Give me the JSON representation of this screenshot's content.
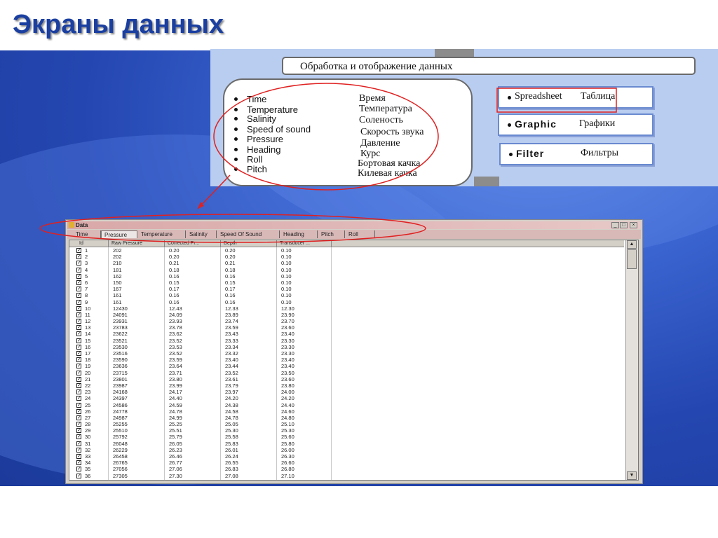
{
  "slide": {
    "title": "Экраны данных"
  },
  "diagram": {
    "process_label": "Обработка и отображение данных",
    "parameters": [
      {
        "en": "Time",
        "ru": "Время"
      },
      {
        "en": "Temperature",
        "ru": "Температура"
      },
      {
        "en": "Salinity",
        "ru": "Соленость"
      },
      {
        "en": "Speed of sound",
        "ru": "Скорость звука"
      },
      {
        "en": "Pressure",
        "ru": "Давление"
      },
      {
        "en": "Heading",
        "ru": "Курс"
      },
      {
        "en": "Roll",
        "ru": "Бортовая качка"
      },
      {
        "en": "Pitch",
        "ru": "Килевая качка"
      }
    ],
    "options": [
      {
        "en": "Spreadsheet",
        "ru": "Таблица"
      },
      {
        "en": "Graphic",
        "ru": "Графики"
      },
      {
        "en": "Filter",
        "ru": "Фильтры"
      }
    ]
  },
  "window": {
    "title": "Data",
    "controls": {
      "minimize": "_",
      "maximize": "□",
      "close": "×"
    },
    "tabs": [
      "Time",
      "Pressure",
      "Temperature",
      "Salinity",
      "Speed Of Sound",
      "Heading",
      "Pitch",
      "Roll"
    ],
    "active_tab": "Pressure",
    "columns": [
      "Id",
      "Raw Pressure",
      "Corrected Pr...",
      "Depth",
      "Transducer ..."
    ],
    "rows": [
      [
        "1",
        "202",
        "0.20",
        "0.20",
        "0.10"
      ],
      [
        "2",
        "202",
        "0.20",
        "0.20",
        "0.10"
      ],
      [
        "3",
        "210",
        "0.21",
        "0.21",
        "0.10"
      ],
      [
        "4",
        "181",
        "0.18",
        "0.18",
        "0.10"
      ],
      [
        "5",
        "162",
        "0.16",
        "0.16",
        "0.10"
      ],
      [
        "6",
        "150",
        "0.15",
        "0.15",
        "0.10"
      ],
      [
        "7",
        "167",
        "0.17",
        "0.17",
        "0.10"
      ],
      [
        "8",
        "161",
        "0.16",
        "0.16",
        "0.10"
      ],
      [
        "9",
        "161",
        "0.16",
        "0.16",
        "0.10"
      ],
      [
        "10",
        "12430",
        "12.43",
        "12.33",
        "12.30"
      ],
      [
        "11",
        "24091",
        "24.09",
        "23.89",
        "23.90"
      ],
      [
        "12",
        "23931",
        "23.93",
        "23.74",
        "23.70"
      ],
      [
        "13",
        "23783",
        "23.78",
        "23.59",
        "23.60"
      ],
      [
        "14",
        "23622",
        "23.62",
        "23.43",
        "23.40"
      ],
      [
        "15",
        "23521",
        "23.52",
        "23.33",
        "23.30"
      ],
      [
        "16",
        "23530",
        "23.53",
        "23.34",
        "23.30"
      ],
      [
        "17",
        "23516",
        "23.52",
        "23.32",
        "23.30"
      ],
      [
        "18",
        "23590",
        "23.59",
        "23.40",
        "23.40"
      ],
      [
        "19",
        "23636",
        "23.64",
        "23.44",
        "23.40"
      ],
      [
        "20",
        "23715",
        "23.71",
        "23.52",
        "23.50"
      ],
      [
        "21",
        "23801",
        "23.80",
        "23.61",
        "23.60"
      ],
      [
        "22",
        "23987",
        "23.99",
        "23.79",
        "23.80"
      ],
      [
        "23",
        "24168",
        "24.17",
        "23.97",
        "24.00"
      ],
      [
        "24",
        "24397",
        "24.40",
        "24.20",
        "24.20"
      ],
      [
        "25",
        "24586",
        "24.59",
        "24.38",
        "24.40"
      ],
      [
        "26",
        "24778",
        "24.78",
        "24.58",
        "24.60"
      ],
      [
        "27",
        "24987",
        "24.99",
        "24.78",
        "24.80"
      ],
      [
        "28",
        "25255",
        "25.25",
        "25.05",
        "25.10"
      ],
      [
        "29",
        "25510",
        "25.51",
        "25.30",
        "25.30"
      ],
      [
        "30",
        "25792",
        "25.79",
        "25.58",
        "25.60"
      ],
      [
        "31",
        "26048",
        "26.05",
        "25.83",
        "25.80"
      ],
      [
        "32",
        "26229",
        "26.23",
        "26.01",
        "26.00"
      ],
      [
        "33",
        "26458",
        "26.46",
        "26.24",
        "26.30"
      ],
      [
        "34",
        "26765",
        "26.77",
        "26.55",
        "26.60"
      ],
      [
        "35",
        "27056",
        "27.06",
        "26.83",
        "26.80"
      ],
      [
        "36",
        "27305",
        "27.30",
        "27.08",
        "27.10"
      ]
    ],
    "scroll_up": "▲",
    "scroll_down": "▼",
    "check_mark": "✓"
  },
  "colors": {
    "annotation": "#e02020",
    "title": "#1a3fa0",
    "background": "#2a4bb5"
  }
}
